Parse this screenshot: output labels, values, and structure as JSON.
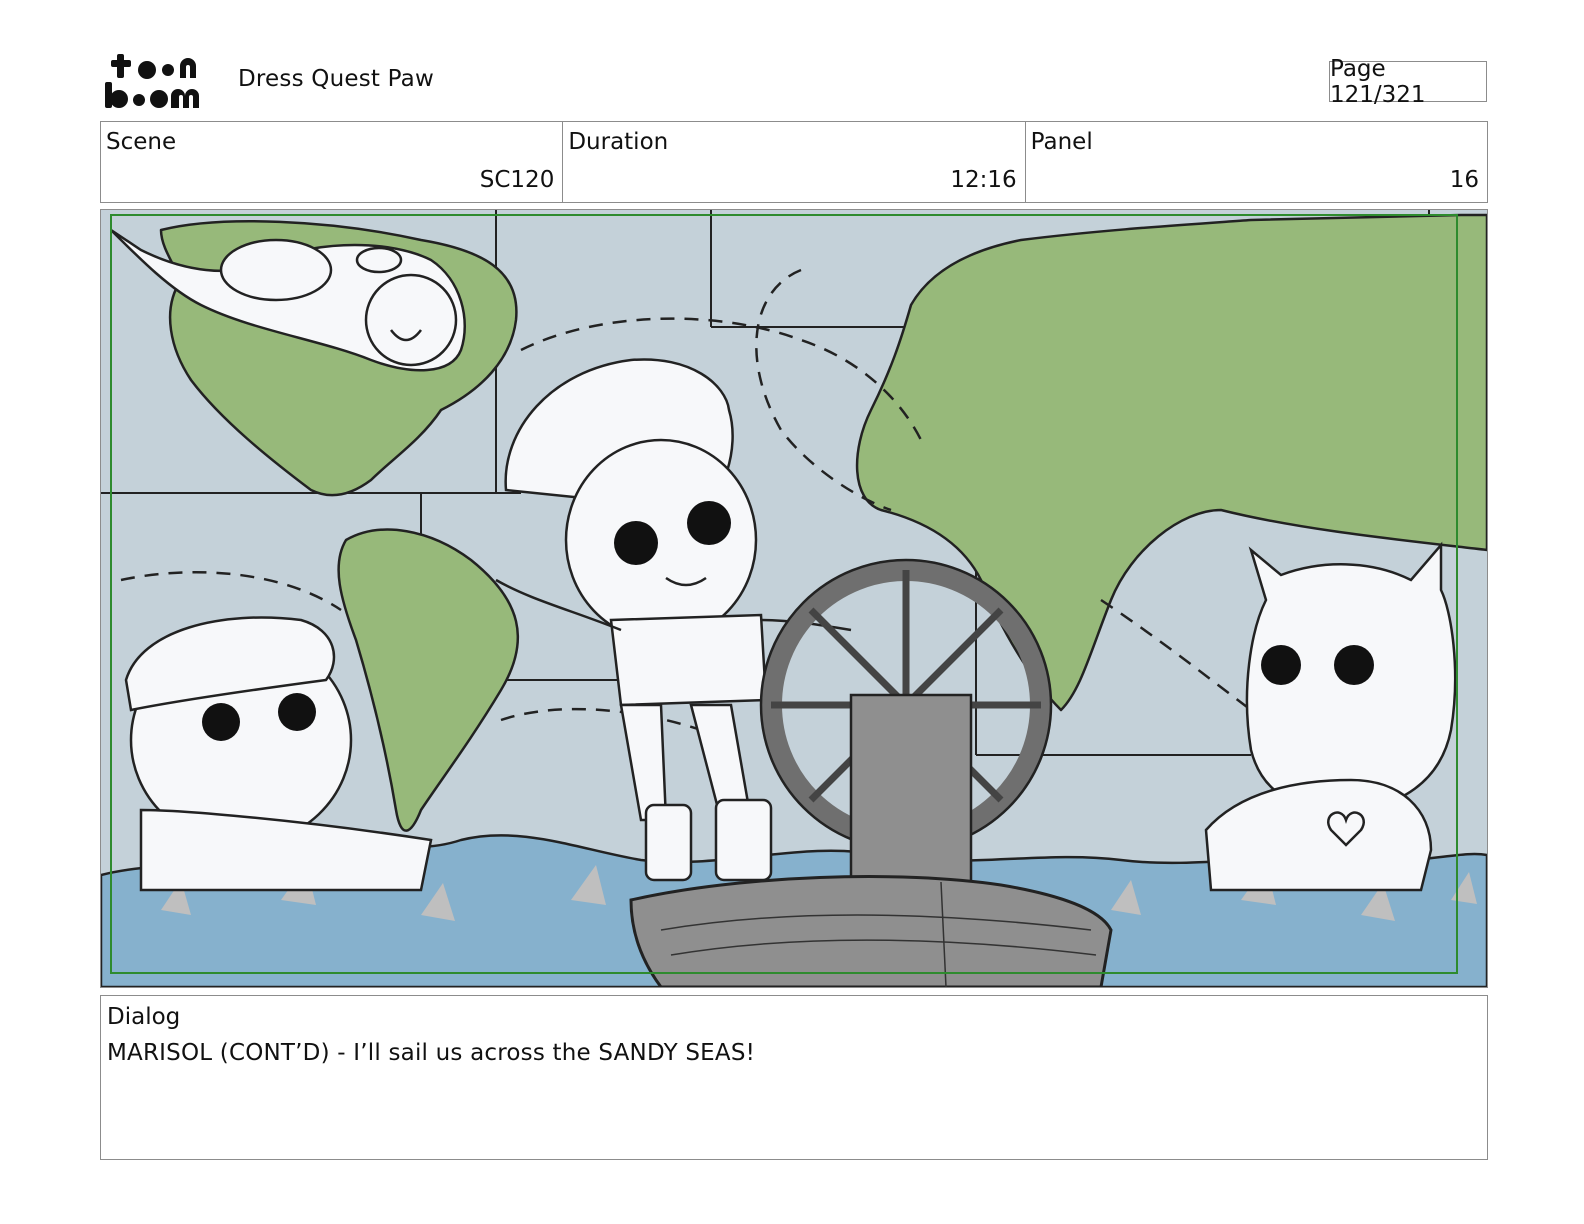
{
  "logo": {
    "line1": "toon",
    "line2": "boom",
    "icon": "toon-boom-logo"
  },
  "header": {
    "project_title": "Dress Quest Paw",
    "page_label": "Page 121/321"
  },
  "scene": {
    "label": "Scene",
    "value": "SC120"
  },
  "duration": {
    "label": "Duration",
    "value": "12:16"
  },
  "panel": {
    "label": "Panel",
    "value": "16"
  },
  "artwork": {
    "description_icon": "storyboard-panel-drawing",
    "colors": {
      "sea": "#c4d1d9",
      "land": "#97b97a",
      "water": "#86b1cd",
      "boat": "#8f8f8f",
      "safe_frame": "#2e8b2e"
    }
  },
  "dialog": {
    "label": "Dialog",
    "text": "MARISOL (CONT’D) - I’ll sail us across the SANDY SEAS!"
  }
}
